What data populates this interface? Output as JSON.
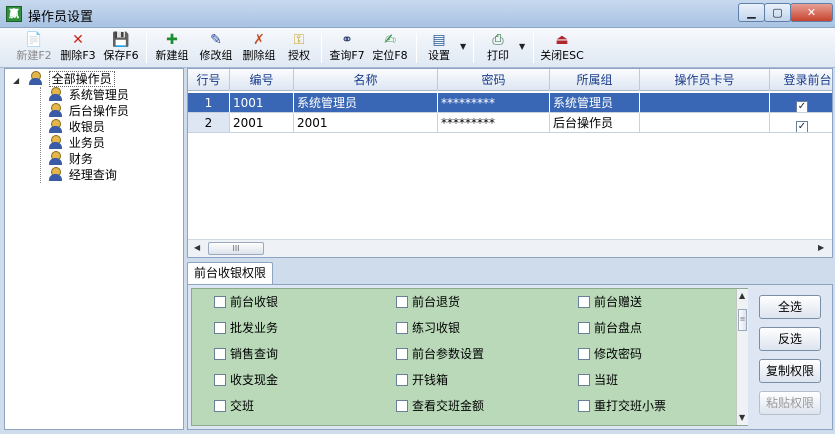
{
  "window": {
    "title": "操作员设置",
    "app_icon_text": "赢",
    "min": "▁",
    "max": "▢",
    "close": "✕"
  },
  "toolbar": {
    "new_label": "新建F2",
    "delete_label": "删除F3",
    "save_label": "保存F6",
    "new_group_label": "新建组",
    "edit_group_label": "修改组",
    "delete_group_label": "删除组",
    "authorize_label": "授权",
    "query_label": "查询F7",
    "locate_label": "定位F8",
    "settings_label": "设置",
    "print_label": "打印",
    "close_label": "关闭ESC"
  },
  "tree": {
    "root": "全部操作员",
    "children": [
      "系统管理员",
      "后台操作员",
      "收银员",
      "业务员",
      "财务",
      "经理查询"
    ]
  },
  "grid": {
    "headers": [
      "行号",
      "编号",
      "名称",
      "密码",
      "所属组",
      "操作员卡号",
      "登录前台"
    ],
    "rows": [
      {
        "rownum": "1",
        "code": "1001",
        "name": "系统管理员",
        "password": "*********",
        "group": "系统管理员",
        "card": "",
        "login": "✓"
      },
      {
        "rownum": "2",
        "code": "2001",
        "name": "2001",
        "password": "*********",
        "group": "后台操作员",
        "card": "",
        "login": "✓"
      }
    ],
    "scroll_thumb": "III"
  },
  "tab": {
    "label": "前台收银权限"
  },
  "permissions": [
    [
      "前台收银",
      "前台退货",
      "前台赠送"
    ],
    [
      "批发业务",
      "练习收银",
      "前台盘点"
    ],
    [
      "销售查询",
      "前台参数设置",
      "修改密码"
    ],
    [
      "收支现金",
      "开钱箱",
      "当班"
    ],
    [
      "交班",
      "查看交班金额",
      "重打交班小票"
    ]
  ],
  "side_buttons": {
    "select_all": "全选",
    "invert": "反选",
    "copy": "复制权限",
    "paste": "粘贴权限"
  }
}
